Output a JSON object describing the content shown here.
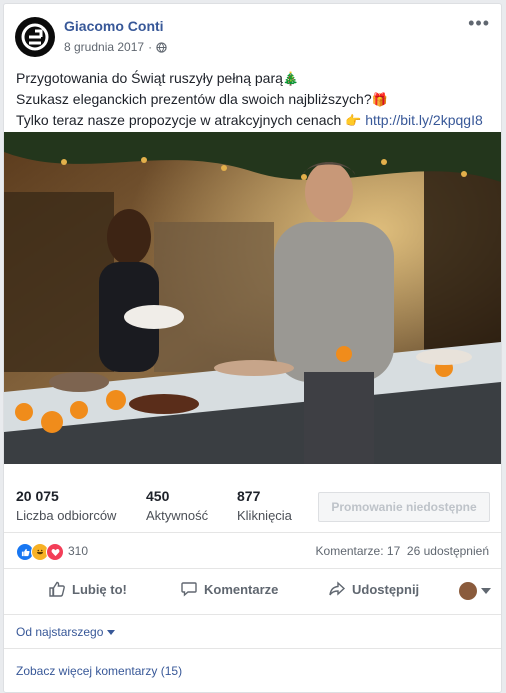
{
  "post": {
    "author": "Giacomo Conti",
    "date": "8 grudnia 2017",
    "dot": "·",
    "lines": [
      "Przygotowania do Świąt ruszyły pełną parą",
      "Szukasz eleganckich prezentów dla swoich najbliższych?",
      "Tylko teraz nasze propozycje w atrakcyjnych cenach"
    ],
    "link": "http://bit.ly/2kpqgI8",
    "emojis": {
      "tree": "🎄",
      "gift": "🎁",
      "hand": "👉"
    }
  },
  "stats": [
    {
      "num": "20 075",
      "label": "Liczba odbiorców"
    },
    {
      "num": "450",
      "label": "Aktywność"
    },
    {
      "num": "877",
      "label": "Kliknięcia"
    }
  ],
  "promo_label": "Promowanie niedostępne",
  "reactions": {
    "count": "310",
    "comments": "Komentarze: 17",
    "shares": "26 udostępnień"
  },
  "actions": {
    "like": "Lubię to!",
    "comment": "Komentarze",
    "share": "Udostępnij"
  },
  "sort_label": "Od najstarszego",
  "more_comments": "Zobacz więcej komentarzy (15)",
  "colors": {
    "link": "#385898",
    "like_blue": "#1877f2",
    "love_red": "#f33e58",
    "haha_yellow": "#f7b125"
  }
}
